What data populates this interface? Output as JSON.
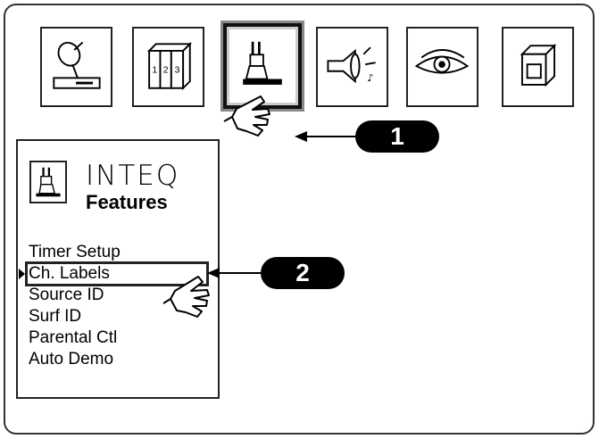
{
  "toolbar": {
    "icons": [
      {
        "name": "satellite-dish-icon",
        "selected": false
      },
      {
        "name": "numbered-books-icon",
        "labels": [
          "1",
          "2",
          "3"
        ],
        "selected": false
      },
      {
        "name": "features-rabbit-icon",
        "selected": true
      },
      {
        "name": "speaker-icon",
        "selected": false
      },
      {
        "name": "eye-icon",
        "selected": false
      },
      {
        "name": "cube-icon",
        "selected": false
      }
    ]
  },
  "menu": {
    "brand": "INTEQ",
    "title": "Features",
    "items": [
      "Timer Setup",
      "Ch. Labels",
      "Source ID",
      "Surf ID",
      "Parental Ctl",
      "Auto Demo"
    ],
    "selected_index": 1
  },
  "callouts": [
    {
      "label": "1",
      "points_to": "features-rabbit-icon"
    },
    {
      "label": "2",
      "points_to": "Ch. Labels"
    }
  ],
  "colors": {
    "ink": "#000000",
    "paper": "#ffffff"
  }
}
